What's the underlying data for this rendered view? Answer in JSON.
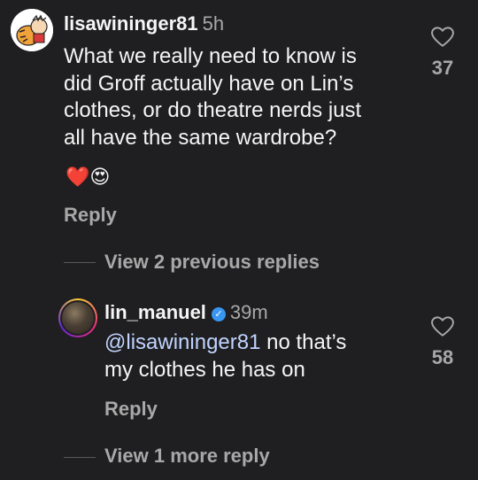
{
  "comments": [
    {
      "username": "lisawininger81",
      "time": "5h",
      "text": "What we really need to know is did Groff actually have on Lin’s clothes, or do theatre nerds just all have the same wardrobe?",
      "text_lines": [
        "What we really need to know is",
        "did Groff actually have on Lin’s",
        "clothes, or do theatre nerds just",
        "all have the same wardrobe?"
      ],
      "reactions": "❤️😍",
      "likes": "37",
      "reply_label": "Reply",
      "view_replies_label": "View 2 previous replies"
    },
    {
      "username": "lin_manuel",
      "verified": true,
      "time": "39m",
      "mention": "@lisawininger81",
      "text_rest_line1": " no that’s",
      "text_line2": "my clothes he has on",
      "likes": "58",
      "reply_label": "Reply",
      "view_replies_label": "View 1 more reply"
    }
  ],
  "colors": {
    "background": "#1f1f21",
    "text": "#f5f5f5",
    "secondary": "#a8a8a8",
    "mention": "#c0d4ff",
    "verified": "#3897f0"
  },
  "icons": [
    "heart-outline-icon",
    "verified-badge-icon"
  ]
}
